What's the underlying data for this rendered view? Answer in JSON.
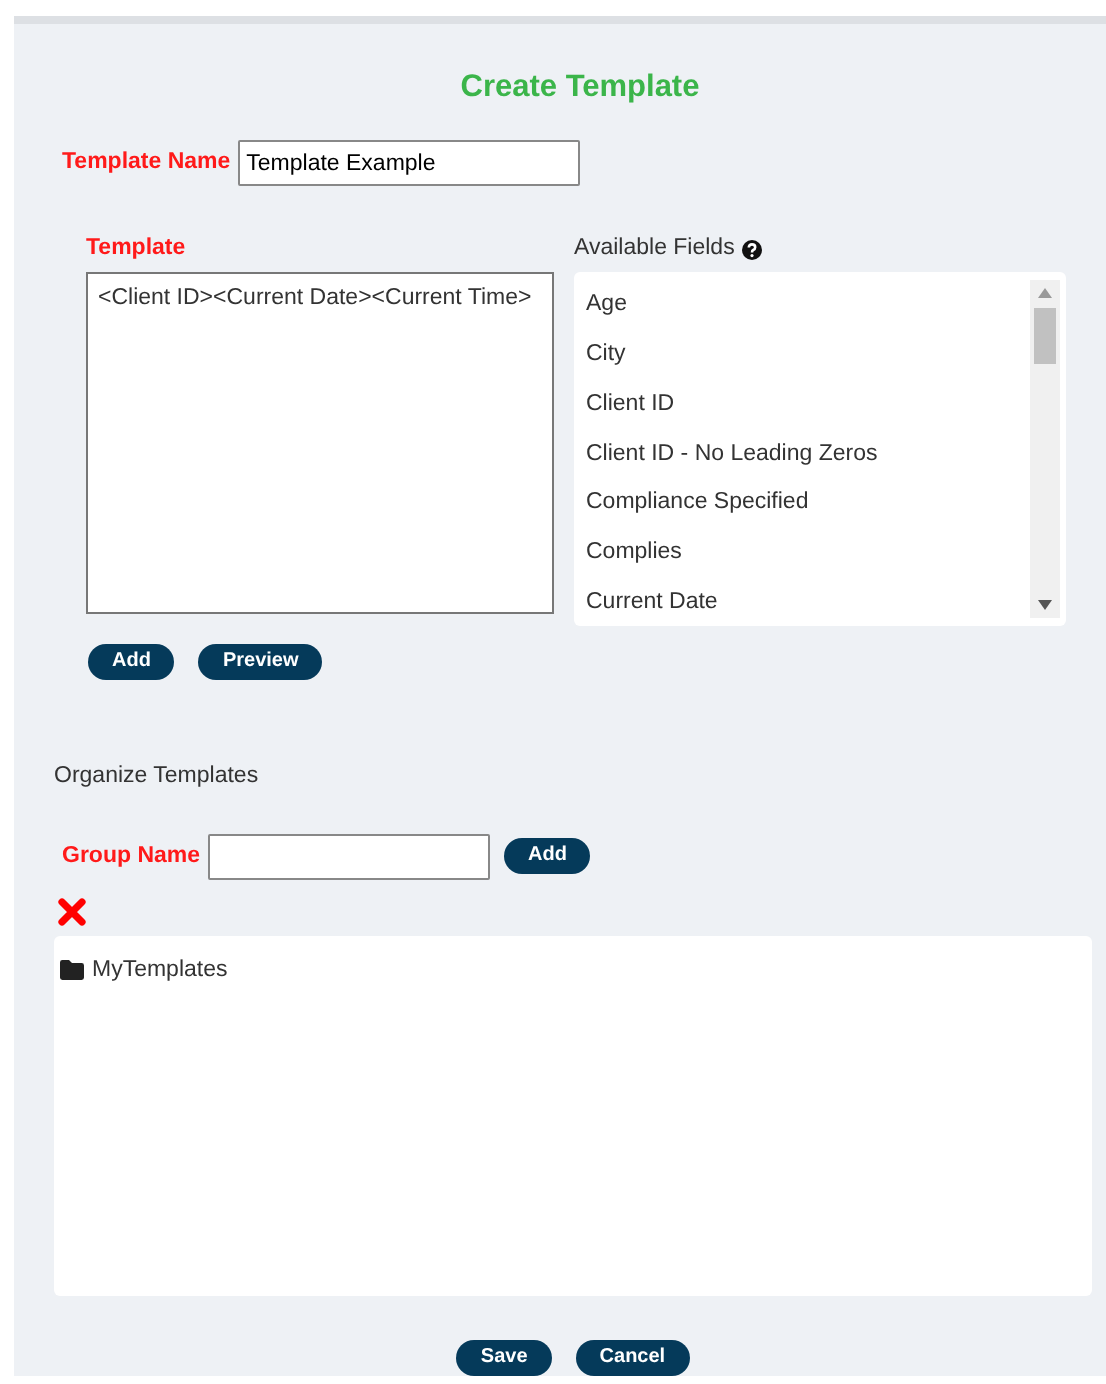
{
  "title": "Create Template",
  "template_name": {
    "label": "Template Name",
    "value": "Template Example"
  },
  "template": {
    "label": "Template",
    "value": "<Client ID><Current Date><Current Time>"
  },
  "available_fields": {
    "label": "Available Fields",
    "items": [
      {
        "label": "Age",
        "selected": false
      },
      {
        "label": "City",
        "selected": false
      },
      {
        "label": "Client ID",
        "selected": false
      },
      {
        "label": "Client ID - No Leading Zeros",
        "selected": false
      },
      {
        "label": "Compliance Specified",
        "selected": false
      },
      {
        "label": "Complies",
        "selected": false
      },
      {
        "label": "Current Date",
        "selected": false
      }
    ]
  },
  "template_buttons": [
    "Add",
    "Preview"
  ],
  "organize": {
    "heading": "Organize Templates",
    "group_label": "Group Name",
    "add_button": "Add",
    "tree": [
      {
        "label": "MyTemplates",
        "kind": "folder"
      }
    ]
  },
  "footer_buttons": [
    "Save",
    "Cancel"
  ]
}
